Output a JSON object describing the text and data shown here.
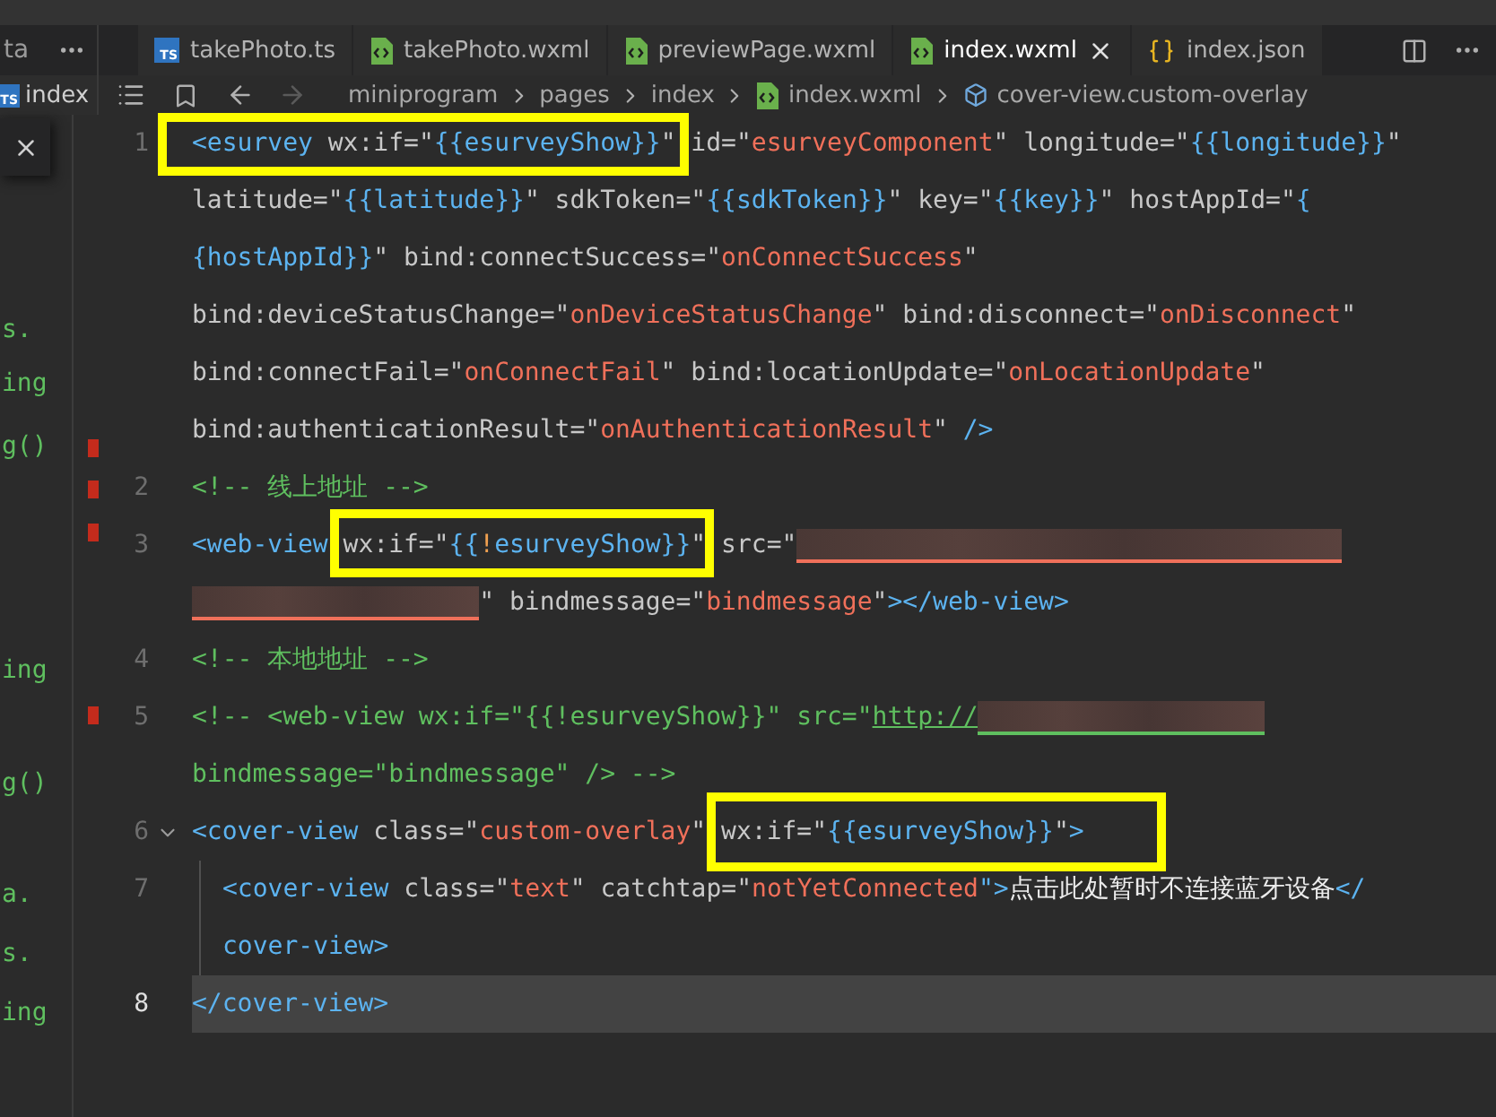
{
  "left_panel": {
    "header": "ta",
    "open_file": {
      "name": "index",
      "badge": "TS"
    },
    "fragments": [
      {
        "text": "s."
      },
      {
        "text": "ing"
      },
      {
        "text": "g()"
      },
      {
        "text": "ing"
      },
      {
        "text": "g()"
      },
      {
        "text": "a."
      },
      {
        "text": "s."
      },
      {
        "text": "ing"
      }
    ]
  },
  "tabs": [
    {
      "label": "takePhoto.ts",
      "kind": "ts",
      "badge": "TS",
      "selected": false
    },
    {
      "label": "takePhoto.wxml",
      "kind": "wxml",
      "selected": false
    },
    {
      "label": "previewPage.wxml",
      "kind": "wxml",
      "selected": false
    },
    {
      "label": "index.wxml",
      "kind": "wxml",
      "selected": true
    },
    {
      "label": "index.json",
      "kind": "json",
      "selected": false
    }
  ],
  "breadcrumb": [
    {
      "label": "miniprogram",
      "kind": "folder"
    },
    {
      "label": "pages",
      "kind": "folder"
    },
    {
      "label": "index",
      "kind": "folder"
    },
    {
      "label": "index.wxml",
      "kind": "wxml"
    },
    {
      "label": "cover-view.custom-overlay",
      "kind": "element"
    }
  ],
  "code": [
    {
      "number": "1",
      "current": false,
      "rows": [
        {
          "tokens": [
            {
              "kind": "tag",
              "text": "<esurvey"
            },
            {
              "kind": "attr",
              "text": " wx:if=\""
            },
            {
              "kind": "expr",
              "text": "{{esurveyShow}}"
            },
            {
              "kind": "attr",
              "text": "\" id=\""
            },
            {
              "kind": "string",
              "text": "esurveyComponent"
            },
            {
              "kind": "attr",
              "text": "\" longitude=\""
            },
            {
              "kind": "expr",
              "text": "{{longitude}}"
            },
            {
              "kind": "attr",
              "text": "\""
            }
          ]
        },
        {
          "tokens": [
            {
              "kind": "attr",
              "text": "latitude=\""
            },
            {
              "kind": "expr",
              "text": "{{latitude}}"
            },
            {
              "kind": "attr",
              "text": "\" sdkToken=\""
            },
            {
              "kind": "expr",
              "text": "{{sdkToken}}"
            },
            {
              "kind": "attr",
              "text": "\" key=\""
            },
            {
              "kind": "expr",
              "text": "{{key}}"
            },
            {
              "kind": "attr",
              "text": "\" hostAppId=\""
            },
            {
              "kind": "expr",
              "text": "{"
            }
          ]
        },
        {
          "tokens": [
            {
              "kind": "expr",
              "text": "{hostAppId}}"
            },
            {
              "kind": "attr",
              "text": "\" bind:connectSuccess=\""
            },
            {
              "kind": "string",
              "text": "onConnectSuccess"
            },
            {
              "kind": "attr",
              "text": "\""
            }
          ]
        },
        {
          "tokens": [
            {
              "kind": "attr",
              "text": "bind:deviceStatusChange=\""
            },
            {
              "kind": "string",
              "text": "onDeviceStatusChange"
            },
            {
              "kind": "attr",
              "text": "\" bind:disconnect=\""
            },
            {
              "kind": "string",
              "text": "onDisconnect"
            },
            {
              "kind": "attr",
              "text": "\""
            }
          ]
        },
        {
          "tokens": [
            {
              "kind": "attr",
              "text": "bind:connectFail=\""
            },
            {
              "kind": "string",
              "text": "onConnectFail"
            },
            {
              "kind": "attr",
              "text": "\" bind:locationUpdate=\""
            },
            {
              "kind": "string",
              "text": "onLocationUpdate"
            },
            {
              "kind": "attr",
              "text": "\""
            }
          ]
        },
        {
          "tokens": [
            {
              "kind": "attr",
              "text": "bind:authenticationResult=\""
            },
            {
              "kind": "string",
              "text": "onAuthenticationResult"
            },
            {
              "kind": "attr",
              "text": "\" "
            },
            {
              "kind": "tag",
              "text": "/>"
            }
          ]
        }
      ]
    },
    {
      "number": "2",
      "current": false,
      "rows": [
        {
          "tokens": [
            {
              "kind": "comment",
              "text": "<!-- 线上地址 -->"
            }
          ]
        }
      ]
    },
    {
      "number": "3",
      "current": false,
      "rows": [
        {
          "tokens": [
            {
              "kind": "tag",
              "text": "<web-view"
            },
            {
              "kind": "attr",
              "text": " wx:if=\""
            },
            {
              "kind": "expr",
              "text": "{{"
            },
            {
              "kind": "op",
              "text": "!"
            },
            {
              "kind": "expr",
              "text": "esurveyShow}}"
            },
            {
              "kind": "attr",
              "text": "\" src=\""
            },
            {
              "kind": "redacted"
            }
          ]
        },
        {
          "tokens": [
            {
              "kind": "redacted"
            },
            {
              "kind": "attr",
              "text": "\" bindmessage=\""
            },
            {
              "kind": "string",
              "text": "bindmessage"
            },
            {
              "kind": "attr",
              "text": "\""
            },
            {
              "kind": "tag",
              "text": "></web-view>"
            }
          ]
        }
      ]
    },
    {
      "number": "4",
      "current": false,
      "rows": [
        {
          "tokens": [
            {
              "kind": "comment",
              "text": "<!-- 本地地址 -->"
            }
          ]
        }
      ]
    },
    {
      "number": "5",
      "current": false,
      "rows": [
        {
          "tokens": [
            {
              "kind": "comment",
              "text": "<!-- <web-view wx:if=\"{{!esurveyShow}}\" src=\""
            },
            {
              "kind": "link",
              "text": "http://"
            },
            {
              "kind": "redacted"
            }
          ]
        },
        {
          "tokens": [
            {
              "kind": "comment",
              "text": "bindmessage=\"bindmessage\" /> -->"
            }
          ]
        }
      ]
    },
    {
      "number": "6",
      "current": false,
      "expanded": true,
      "rows": [
        {
          "tokens": [
            {
              "kind": "tag",
              "text": "<cover-view"
            },
            {
              "kind": "attr",
              "text": " class=\""
            },
            {
              "kind": "string",
              "text": "custom-overlay"
            },
            {
              "kind": "attr",
              "text": "\" wx:if=\""
            },
            {
              "kind": "expr",
              "text": "{{esurveyShow}}"
            },
            {
              "kind": "attr",
              "text": "\""
            },
            {
              "kind": "tag",
              "text": ">"
            }
          ]
        }
      ],
      "children": [
        {
          "number": "7",
          "current": false,
          "rows": [
            {
              "tokens": [
                {
                  "kind": "tag",
                  "text": "<cover-view"
                },
                {
                  "kind": "attr",
                  "text": " class=\""
                },
                {
                  "kind": "string",
                  "text": "text"
                },
                {
                  "kind": "attr",
                  "text": "\" catchtap=\""
                },
                {
                  "kind": "string",
                  "text": "notYetConnected"
                },
                {
                  "kind": "tag",
                  "text": "\">"
                },
                {
                  "kind": "text",
                  "text": "点击此处暂时不连接蓝牙设备"
                },
                {
                  "kind": "tag",
                  "text": "</"
                }
              ]
            },
            {
              "tokens": [
                {
                  "kind": "tag",
                  "text": "cover-view>"
                }
              ]
            }
          ]
        }
      ]
    },
    {
      "number": "8",
      "current": true,
      "rows": [
        {
          "tokens": [
            {
              "kind": "tag",
              "text": "</cover-view>"
            }
          ]
        }
      ]
    }
  ],
  "annotations": [
    {
      "kind": "box"
    },
    {
      "kind": "box"
    },
    {
      "kind": "box"
    }
  ]
}
